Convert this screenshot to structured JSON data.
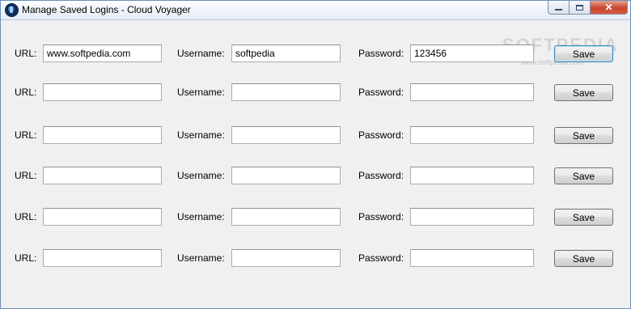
{
  "window": {
    "title": "Manage Saved Logins - Cloud Voyager",
    "close_glyph": "✕"
  },
  "labels": {
    "url": "URL:",
    "username": "Username:",
    "password": "Password:",
    "save": "Save"
  },
  "logins": [
    {
      "url": "www.softpedia.com",
      "username": "softpedia",
      "password": "123456"
    },
    {
      "url": "",
      "username": "",
      "password": ""
    },
    {
      "url": "",
      "username": "",
      "password": ""
    },
    {
      "url": "",
      "username": "",
      "password": ""
    },
    {
      "url": "",
      "username": "",
      "password": ""
    },
    {
      "url": "",
      "username": "",
      "password": ""
    }
  ],
  "watermark": {
    "text": "SOFTPEDIA",
    "sub": "www.softpedia.com"
  },
  "icons": [
    "app-icon",
    "minimize-icon",
    "maximize-icon",
    "close-icon"
  ]
}
